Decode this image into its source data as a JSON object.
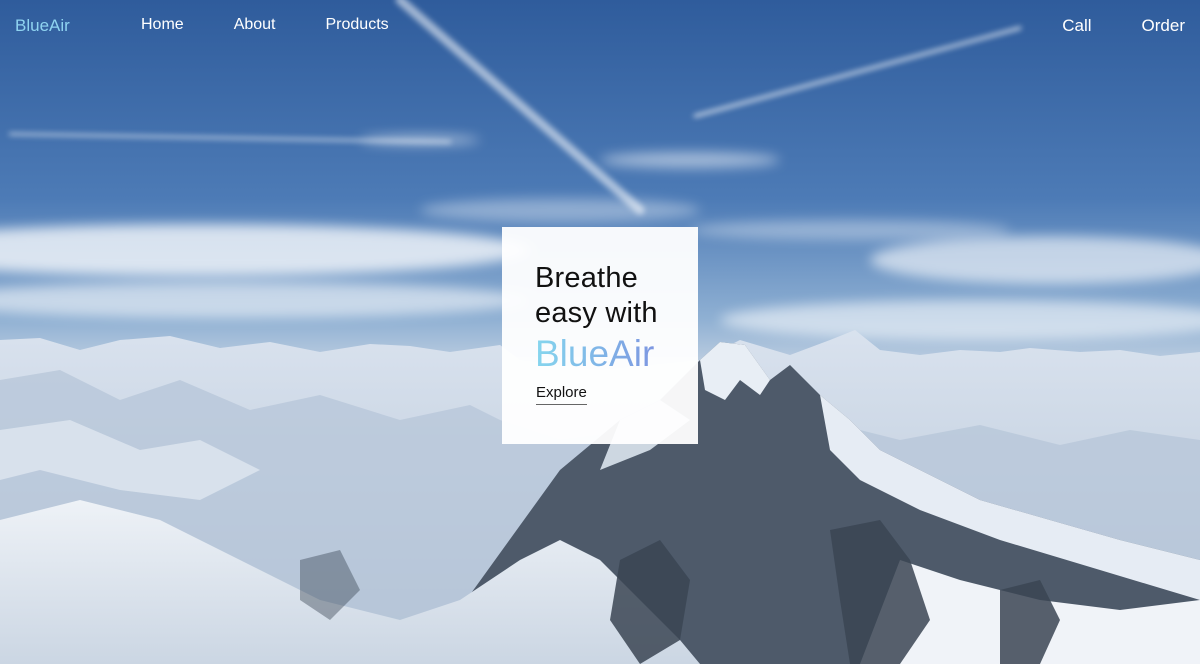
{
  "nav": {
    "brand": "BlueAir",
    "left_links": [
      "Home",
      "About",
      "Products"
    ],
    "right_links": [
      "Call",
      "Order"
    ]
  },
  "hero": {
    "line1": "Breathe",
    "line2": "easy with",
    "brand": "BlueAir",
    "cta": "Explore"
  },
  "colors": {
    "brand_accent": "#8fd3f0",
    "gradient_start": "#86d6ee",
    "gradient_end": "#7d7fdc",
    "nav_text": "#ffffff"
  }
}
